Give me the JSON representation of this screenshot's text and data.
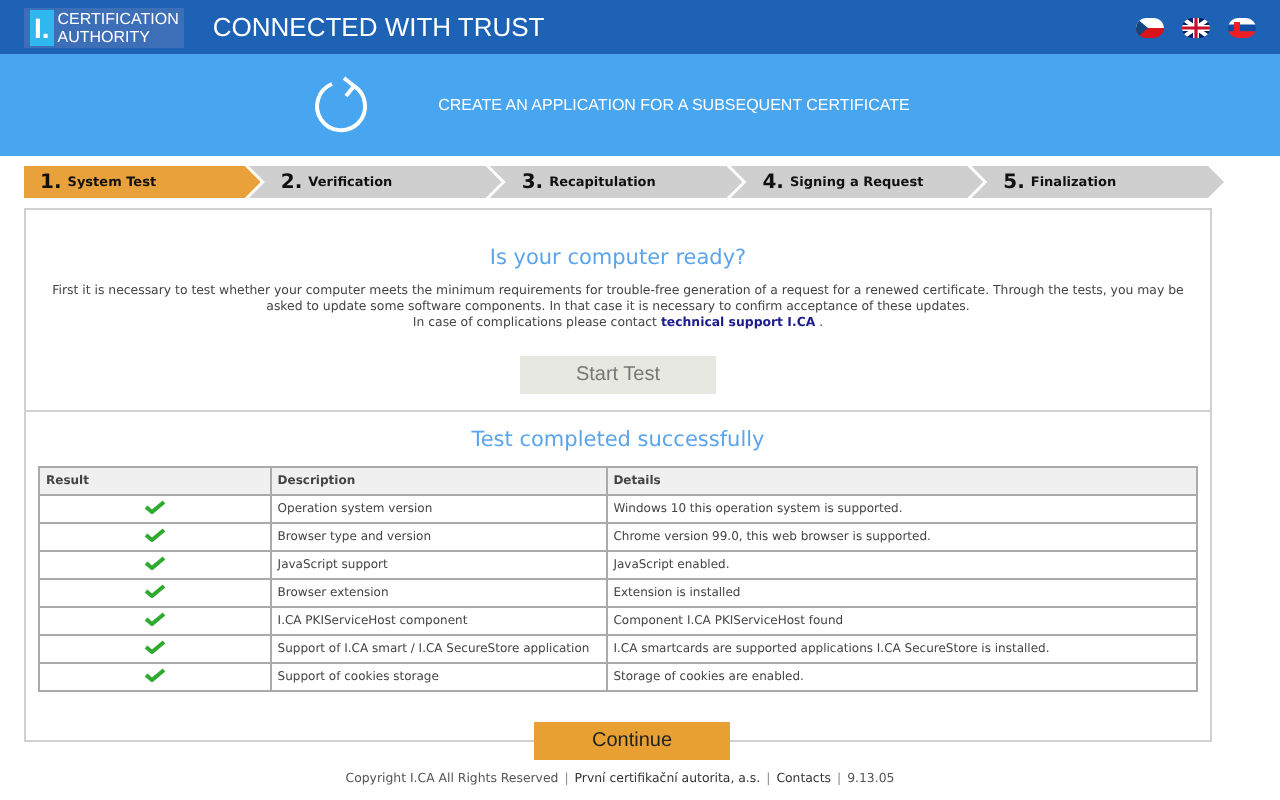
{
  "header": {
    "logo_top": "CERTIFICATION",
    "logo_bottom": "AUTHORITY",
    "logo_mark": "I.",
    "slogan": "CONNECTED WITH TRUST",
    "languages": [
      {
        "kind": "cz"
      },
      {
        "kind": "gb"
      },
      {
        "kind": "sk"
      }
    ]
  },
  "banner": {
    "title": "CREATE AN APPLICATION FOR A SUBSEQUENT CERTIFICATE"
  },
  "steps": [
    {
      "number": "1.",
      "label": "System Test",
      "selected": true
    },
    {
      "number": "2.",
      "label": "Verification",
      "selected": false
    },
    {
      "number": "3.",
      "label": "Recapitulation",
      "selected": false
    },
    {
      "number": "4.",
      "label": "Signing a Request",
      "selected": false
    },
    {
      "number": "5.",
      "label": "Finalization",
      "selected": false
    }
  ],
  "intro": {
    "title": "Is your computer ready?",
    "text": "First it is necessary to test whether your computer meets the minimum requirements for trouble-free generation of a request for a renewed certificate. Through the tests, you may be asked to update some software components. In that case it is necessary to confirm acceptance of these updates.",
    "contact_text": "In case of complications please contact",
    "contact_link": "technical support I.CA",
    "contact_end": ".",
    "button": "Start Test",
    "button_disabled": true
  },
  "results": {
    "title": "Test completed successfully",
    "columns": [
      "Result",
      "Description",
      "Details"
    ],
    "rows": [
      {
        "passed": true,
        "description": "Operation system version",
        "details": "Windows 10 this operation system is supported."
      },
      {
        "passed": true,
        "description": "Browser type and version",
        "details": "Chrome version 99.0, this web browser is supported."
      },
      {
        "passed": true,
        "description": "JavaScript support",
        "details": "JavaScript enabled."
      },
      {
        "passed": true,
        "description": "Browser extension",
        "details": "Extension is installed"
      },
      {
        "passed": true,
        "description": "I.CA PKIServiceHost component",
        "details": "Component I.CA PKIServiceHost found"
      },
      {
        "passed": true,
        "description": "Support of I.CA smart / I.CA SecureStore application",
        "details": "I.CA smartcards are supported applications I.CA SecureStore is installed."
      },
      {
        "passed": true,
        "description": "Support of cookies storage",
        "details": "Storage of cookies are enabled."
      }
    ],
    "button": "Continue"
  },
  "footer": [
    {
      "kind": "text",
      "text": "Copyright I.CA All Rights Reserved"
    },
    {
      "kind": "separator",
      "text": "|"
    },
    {
      "kind": "link",
      "text": "První certifikační autorita, a.s."
    },
    {
      "kind": "separator",
      "text": "|"
    },
    {
      "kind": "link",
      "text": "Contacts"
    },
    {
      "kind": "separator",
      "text": "|"
    },
    {
      "kind": "text",
      "text": "9.13.05"
    }
  ]
}
